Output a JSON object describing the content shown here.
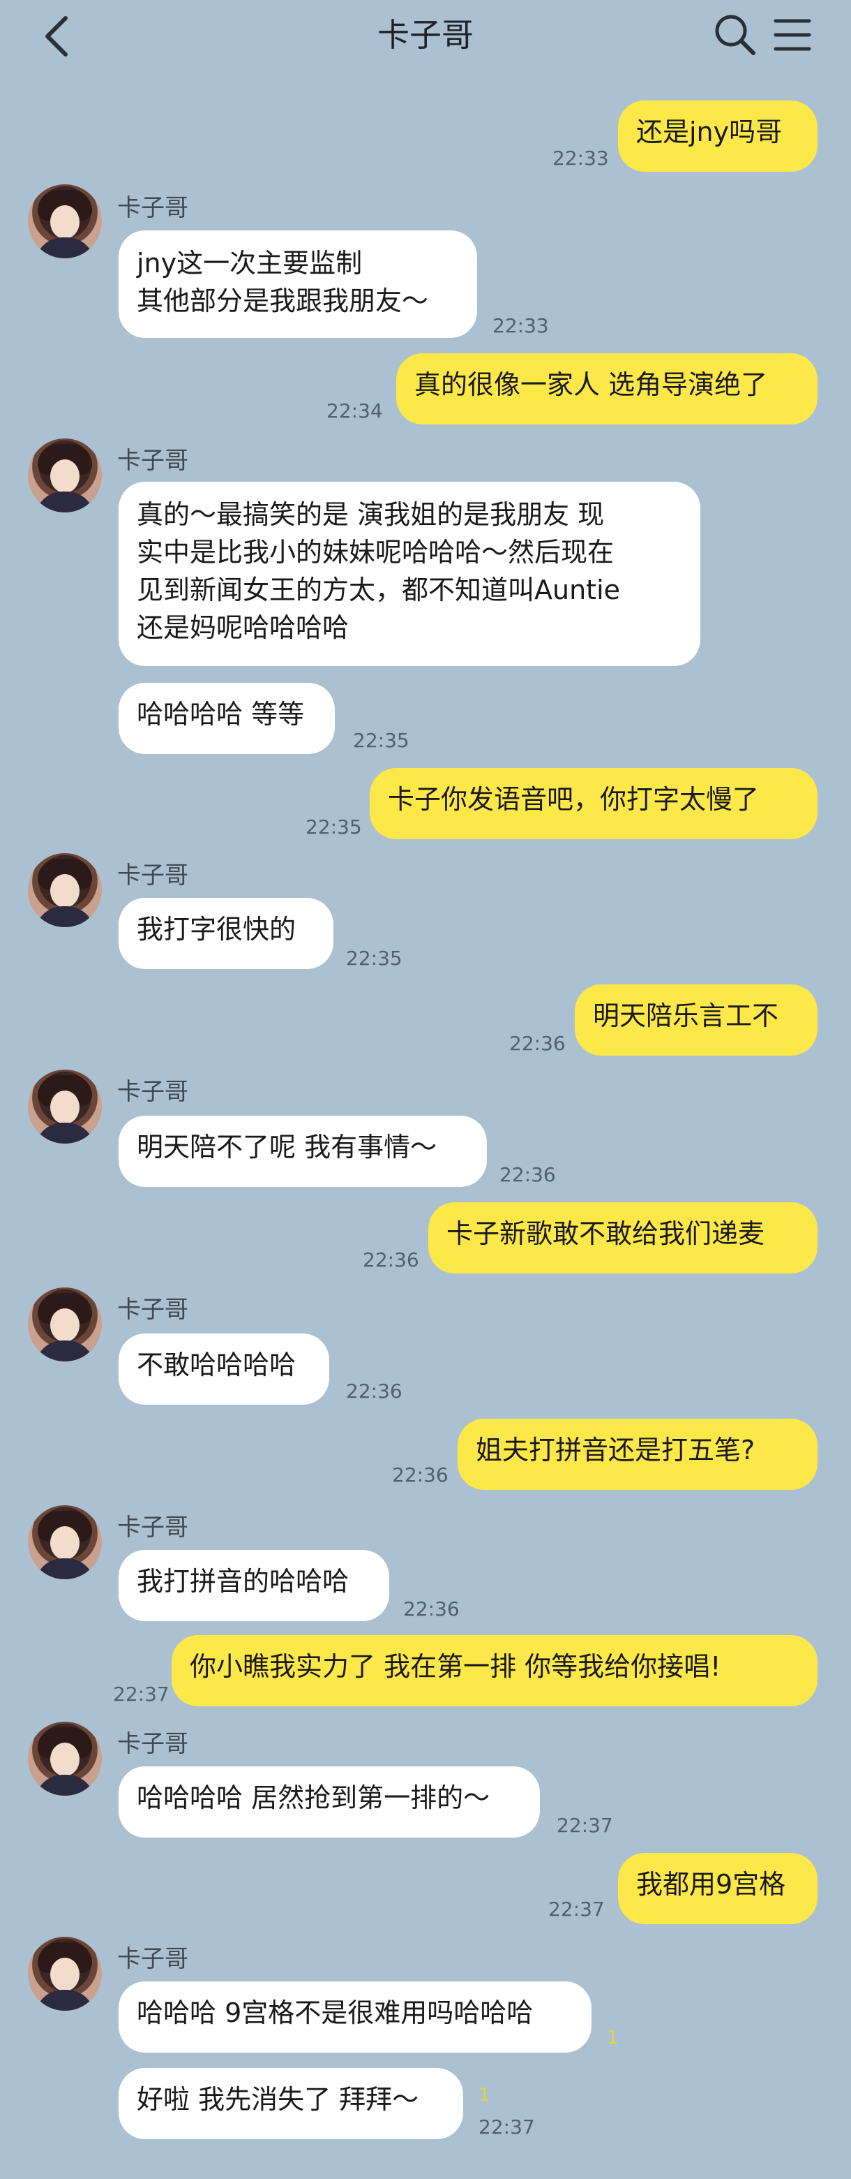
{
  "header": {
    "title": "卡子哥"
  },
  "messages": [
    {
      "side": "out",
      "text": "还是jny吗哥",
      "time": "22:33"
    },
    {
      "side": "in",
      "sender": "卡子哥",
      "text": "jny这一次主要监制\n其他部分是我跟我朋友～",
      "time": "22:33"
    },
    {
      "side": "out",
      "text": "真的很像一家人 选角导演绝了",
      "time": "22:34"
    },
    {
      "side": "in",
      "sender": "卡子哥",
      "text": "真的～最搞笑的是 演我姐的是我朋友 现\n实中是比我小的妹妹呢哈哈哈～然后现在\n见到新闻女王的方太，都不知道叫Auntie\n还是妈呢哈哈哈哈",
      "time": ""
    },
    {
      "side": "in",
      "text": "哈哈哈哈 等等",
      "time": "22:35"
    },
    {
      "side": "out",
      "text": "卡子你发语音吧，你打字太慢了",
      "time": "22:35"
    },
    {
      "side": "in",
      "sender": "卡子哥",
      "text": "我打字很快的",
      "time": "22:35"
    },
    {
      "side": "out",
      "text": "明天陪乐言工不",
      "time": "22:36"
    },
    {
      "side": "in",
      "sender": "卡子哥",
      "text": "明天陪不了呢 我有事情～",
      "time": "22:36"
    },
    {
      "side": "out",
      "text": "卡子新歌敢不敢给我们递麦",
      "time": "22:36"
    },
    {
      "side": "in",
      "sender": "卡子哥",
      "text": "不敢哈哈哈哈",
      "time": "22:36"
    },
    {
      "side": "out",
      "text": "姐夫打拼音还是打五笔?",
      "time": "22:36"
    },
    {
      "side": "in",
      "sender": "卡子哥",
      "text": "我打拼音的哈哈哈",
      "time": "22:36"
    },
    {
      "side": "out",
      "text": "你小瞧我实力了 我在第一排 你等我给你接唱!",
      "time": "22:37"
    },
    {
      "side": "in",
      "sender": "卡子哥",
      "text": "哈哈哈哈 居然抢到第一排的～",
      "time": "22:37"
    },
    {
      "side": "out",
      "text": "我都用9宫格",
      "time": "22:37"
    },
    {
      "side": "in",
      "sender": "卡子哥",
      "text": "哈哈哈 9宫格不是很难用吗哈哈哈",
      "time": "",
      "read": "1"
    },
    {
      "side": "in",
      "text": "好啦 我先消失了 拜拜～",
      "time": "22:37",
      "read": "1"
    }
  ]
}
